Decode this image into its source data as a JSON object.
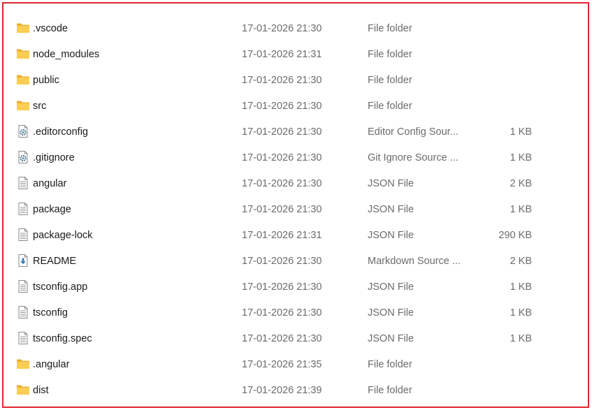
{
  "files": [
    {
      "name": ".vscode",
      "date": "17-01-2026 21:30",
      "type": "File folder",
      "size": "",
      "icon": "folder-icon"
    },
    {
      "name": "node_modules",
      "date": "17-01-2026 21:31",
      "type": "File folder",
      "size": "",
      "icon": "folder-icon"
    },
    {
      "name": "public",
      "date": "17-01-2026 21:30",
      "type": "File folder",
      "size": "",
      "icon": "folder-icon"
    },
    {
      "name": "src",
      "date": "17-01-2026 21:30",
      "type": "File folder",
      "size": "",
      "icon": "folder-icon"
    },
    {
      "name": ".editorconfig",
      "date": "17-01-2026 21:30",
      "type": "Editor Config Sour...",
      "size": "1 KB",
      "icon": "settings-file-icon"
    },
    {
      "name": ".gitignore",
      "date": "17-01-2026 21:30",
      "type": "Git Ignore Source ...",
      "size": "1 KB",
      "icon": "settings-file-icon"
    },
    {
      "name": "angular",
      "date": "17-01-2026 21:30",
      "type": "JSON File",
      "size": "2 KB",
      "icon": "document-icon"
    },
    {
      "name": "package",
      "date": "17-01-2026 21:30",
      "type": "JSON File",
      "size": "1 KB",
      "icon": "document-icon"
    },
    {
      "name": "package-lock",
      "date": "17-01-2026 21:31",
      "type": "JSON File",
      "size": "290 KB",
      "icon": "document-icon"
    },
    {
      "name": "README",
      "date": "17-01-2026 21:30",
      "type": "Markdown Source ...",
      "size": "2 KB",
      "icon": "markdown-file-icon"
    },
    {
      "name": "tsconfig.app",
      "date": "17-01-2026 21:30",
      "type": "JSON File",
      "size": "1 KB",
      "icon": "document-icon"
    },
    {
      "name": "tsconfig",
      "date": "17-01-2026 21:30",
      "type": "JSON File",
      "size": "1 KB",
      "icon": "document-icon"
    },
    {
      "name": "tsconfig.spec",
      "date": "17-01-2026 21:30",
      "type": "JSON File",
      "size": "1 KB",
      "icon": "document-icon"
    },
    {
      "name": ".angular",
      "date": "17-01-2026 21:35",
      "type": "File folder",
      "size": "",
      "icon": "folder-icon"
    },
    {
      "name": "dist",
      "date": "17-01-2026 21:39",
      "type": "File folder",
      "size": "",
      "icon": "folder-icon"
    }
  ],
  "colors": {
    "frame_border": "#e0252e",
    "folder": "#f8c94a",
    "secondary_text": "#6b6b6b"
  }
}
